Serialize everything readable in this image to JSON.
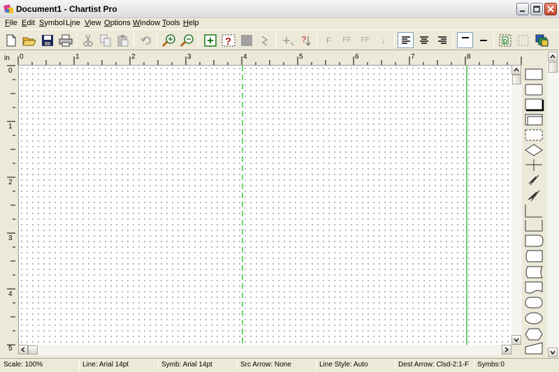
{
  "window": {
    "title": "Document1 - Chartist Pro"
  },
  "menu": {
    "items": [
      {
        "u": "F",
        "rest": "ile"
      },
      {
        "u": "E",
        "rest": "dit"
      },
      {
        "u": "S",
        "rest": "ymbol"
      },
      {
        "pre": "L",
        "u": "i",
        "rest": "ne"
      },
      {
        "u": "V",
        "rest": "iew"
      },
      {
        "u": "O",
        "rest": "ptions"
      },
      {
        "u": "W",
        "rest": "indow"
      },
      {
        "u": "T",
        "rest": "ools"
      },
      {
        "u": "H",
        "rest": "elp"
      }
    ]
  },
  "toolbar": {
    "format_buttons": [
      "F",
      "FF",
      "FF",
      "↓"
    ]
  },
  "ruler": {
    "units": "in",
    "horizontal": [
      "0",
      "1",
      "2",
      "3",
      "4",
      "5",
      "6",
      "7",
      "8"
    ],
    "vertical": [
      "0",
      "1",
      "2",
      "3",
      "4",
      "5"
    ]
  },
  "status": {
    "scale": "Scale: 100%",
    "line": "Line: Arial 14pt",
    "symb": "Symb: Arial 14pt",
    "src_arrow": "Src Arrow: None",
    "line_style": "Line Style: Auto",
    "dest_arrow": "Dest Arrow: Clsd-2:1-F",
    "symbs": "Symbs:0"
  },
  "colors": {
    "page_margin_guide": "#3cc43c",
    "selection_accent": "#7f9db9"
  }
}
